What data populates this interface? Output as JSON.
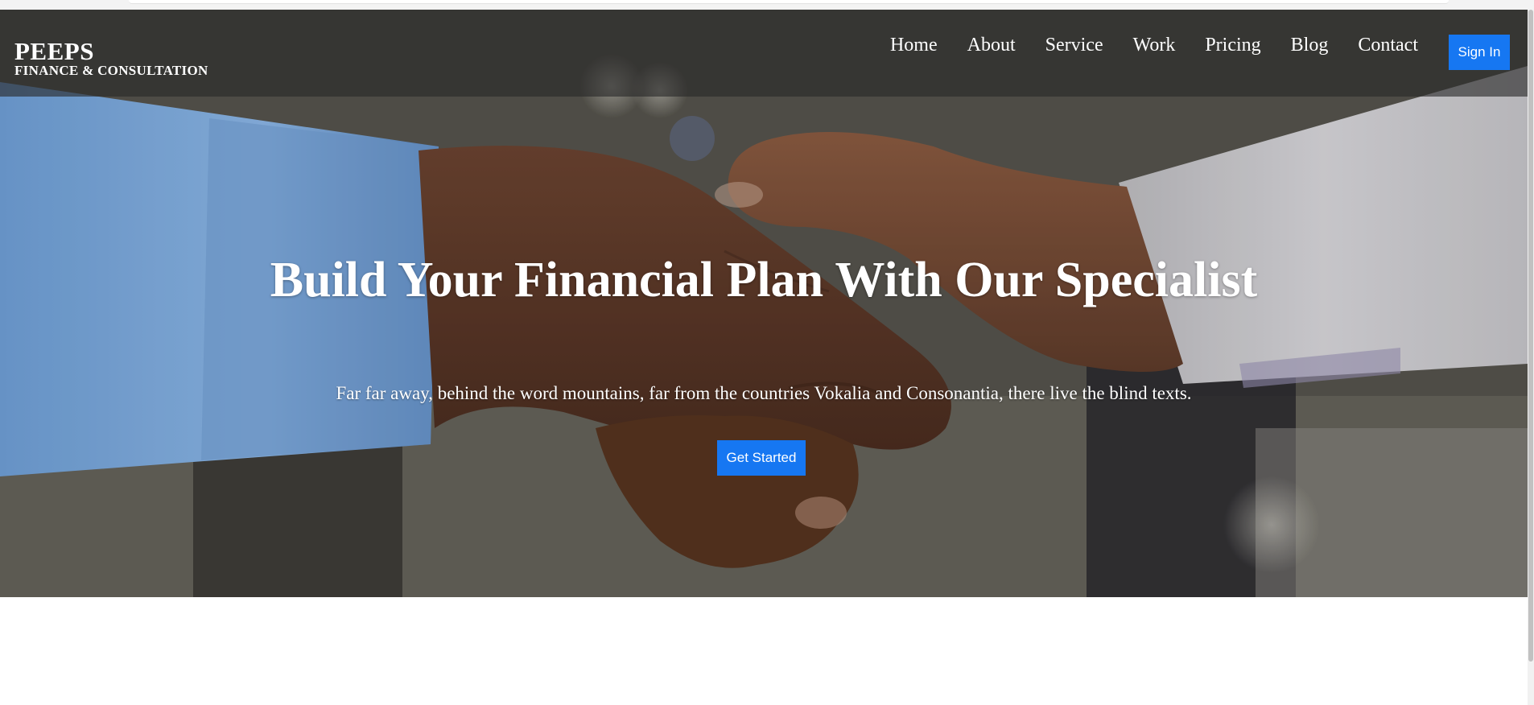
{
  "brand": {
    "name": "PEEPS",
    "tagline": "FINANCE & CONSULTATION"
  },
  "nav": {
    "items": [
      {
        "label": "Home"
      },
      {
        "label": "About"
      },
      {
        "label": "Service"
      },
      {
        "label": "Work"
      },
      {
        "label": "Pricing"
      },
      {
        "label": "Blog"
      },
      {
        "label": "Contact"
      }
    ],
    "signin_label": "Sign In"
  },
  "hero": {
    "title": "Build Your Financial Plan With Our Specialist",
    "subtitle": "Far far away, behind the word mountains, far from the countries Vokalia and Consonantia, there live the blind texts.",
    "cta_label": "Get Started",
    "background": "handshake-photo"
  },
  "colors": {
    "accent": "#1677f2",
    "navbar_bg": "#282828",
    "text_on_dark": "#ffffff"
  }
}
